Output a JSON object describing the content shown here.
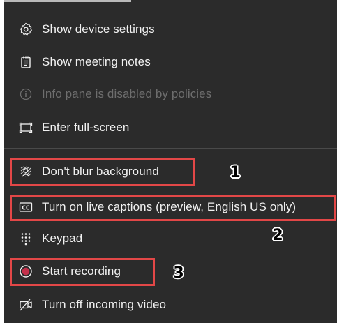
{
  "menu": {
    "items": [
      {
        "id": "show-device-settings",
        "label": "Show device settings",
        "icon": "gear-icon",
        "enabled": true
      },
      {
        "id": "show-meeting-notes",
        "label": "Show meeting notes",
        "icon": "notes-icon",
        "enabled": true
      },
      {
        "id": "info-pane",
        "label": "Info pane is disabled by policies",
        "icon": "info-icon",
        "enabled": false
      },
      {
        "id": "enter-full-screen",
        "label": "Enter full-screen",
        "icon": "fullscreen-icon",
        "enabled": true
      },
      {
        "id": "dont-blur-background",
        "label": "Don't blur background",
        "icon": "blur-background-icon",
        "enabled": true
      },
      {
        "id": "live-captions",
        "label": "Turn on live captions (preview, English US only)",
        "icon": "closed-captions-icon",
        "enabled": true
      },
      {
        "id": "keypad",
        "label": "Keypad",
        "icon": "keypad-icon",
        "enabled": true
      },
      {
        "id": "start-recording",
        "label": "Start recording",
        "icon": "record-icon",
        "enabled": true
      },
      {
        "id": "turn-off-incoming-video",
        "label": "Turn off incoming video",
        "icon": "video-off-icon",
        "enabled": true
      }
    ]
  },
  "annotations": {
    "callout_1": "1",
    "callout_2": "2",
    "callout_3": "3"
  },
  "colors": {
    "menu_background": "#2b2b2b",
    "text": "#f1f1f1",
    "disabled_text": "#6e6e6e",
    "highlight_border": "#e24747",
    "record_dot": "#c4314b"
  }
}
